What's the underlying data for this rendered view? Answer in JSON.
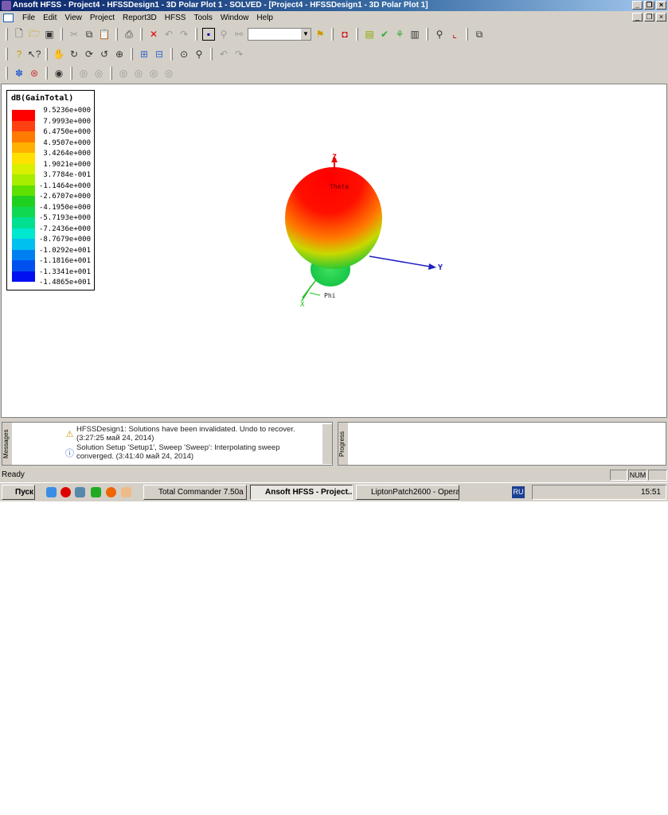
{
  "title": "Ansoft HFSS - Project4 - HFSSDesign1 - 3D Polar Plot 1 - SOLVED - [Project4 - HFSSDesign1 - 3D Polar Plot 1]",
  "window_controls": {
    "minimize": "_",
    "restore": "❐",
    "close": "×"
  },
  "menu": [
    "File",
    "Edit",
    "View",
    "Project",
    "Report3D",
    "HFSS",
    "Tools",
    "Window",
    "Help"
  ],
  "legend": {
    "title": "dB(GainTotal)",
    "labels": [
      "9.5236e+000",
      "7.9993e+000",
      "6.4750e+000",
      "4.9507e+000",
      "3.4264e+000",
      "1.9021e+000",
      "3.7784e-001",
      "-1.1464e+000",
      "-2.6707e+000",
      "-4.1950e+000",
      "-5.7193e+000",
      "-7.2436e+000",
      "-8.7679e+000",
      "-1.0292e+001",
      "-1.1816e+001",
      "-1.3341e+001",
      "-1.4865e+001"
    ],
    "colors": [
      "#ff0000",
      "#ff4010",
      "#ff7a00",
      "#ffb000",
      "#ffe000",
      "#d8f000",
      "#a8ec00",
      "#60e000",
      "#20d020",
      "#10d850",
      "#00e090",
      "#00e8d0",
      "#00c0f0",
      "#0080f0",
      "#0050f0",
      "#0010f0"
    ]
  },
  "axes": {
    "z": "Z",
    "y": "Y",
    "x": "X",
    "theta": "Theta",
    "phi": "Phi"
  },
  "messages": {
    "tab": "Messages",
    "items": [
      {
        "icon": "warning",
        "text": "HFSSDesign1: Solutions have been invalidated. Undo to recover. (3:27:25 май 24, 2014)"
      },
      {
        "icon": "info",
        "text": "Solution Setup 'Setup1', Sweep 'Sweep': Interpolating sweep converged. (3:41:40 май 24, 2014)"
      }
    ]
  },
  "progress": {
    "tab": "Progress"
  },
  "status": {
    "text": "Ready",
    "num": "NUM"
  },
  "taskbar": {
    "start": "Пуск",
    "tasks": [
      "Total Commander 7.50a ...",
      "Ansoft HFSS - Project...",
      "LiptonPatch2600 - Opera"
    ],
    "lang": "RU",
    "clock": "15:51"
  }
}
